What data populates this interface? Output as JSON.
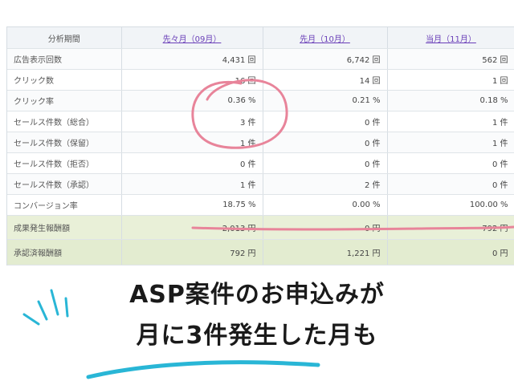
{
  "table": {
    "header_label": "分析期間",
    "columns": [
      "先々月（09月）",
      "先月（10月）",
      "当月（11月）"
    ],
    "rows": [
      {
        "label": "広告表示回数",
        "values": [
          "4,431 回",
          "6,742 回",
          "562 回"
        ]
      },
      {
        "label": "クリック数",
        "values": [
          "16 回",
          "14 回",
          "1 回"
        ]
      },
      {
        "label": "クリック率",
        "values": [
          "0.36 %",
          "0.21 %",
          "0.18 %"
        ]
      },
      {
        "label": "セールス件数（総合）",
        "values": [
          "3 件",
          "0 件",
          "1 件"
        ]
      },
      {
        "label": "セールス件数（保留）",
        "values": [
          "1 件",
          "0 件",
          "1 件"
        ]
      },
      {
        "label": "セールス件数（拒否）",
        "values": [
          "0 件",
          "0 件",
          "0 件"
        ]
      },
      {
        "label": "セールス件数（承認）",
        "values": [
          "1 件",
          "2 件",
          "0 件"
        ]
      },
      {
        "label": "コンバージョン率",
        "values": [
          "18.75 %",
          "0.00 %",
          "100.00 %"
        ]
      },
      {
        "label": "成果発生報酬額",
        "values": [
          "2,013 円",
          "0 円",
          "792 円"
        ]
      },
      {
        "label": "承認済報酬額",
        "values": [
          "792 円",
          "1,221 円",
          "0 円"
        ]
      }
    ]
  },
  "caption": {
    "line1": "ASP案件のお申込みが",
    "line2": "月に3件発生した月も"
  },
  "colors": {
    "annotation_pink": "#e8849a",
    "accent_cyan": "#29b6d6",
    "link_purple": "#6a3fb8",
    "highlight_green": "#e9f0d8"
  }
}
